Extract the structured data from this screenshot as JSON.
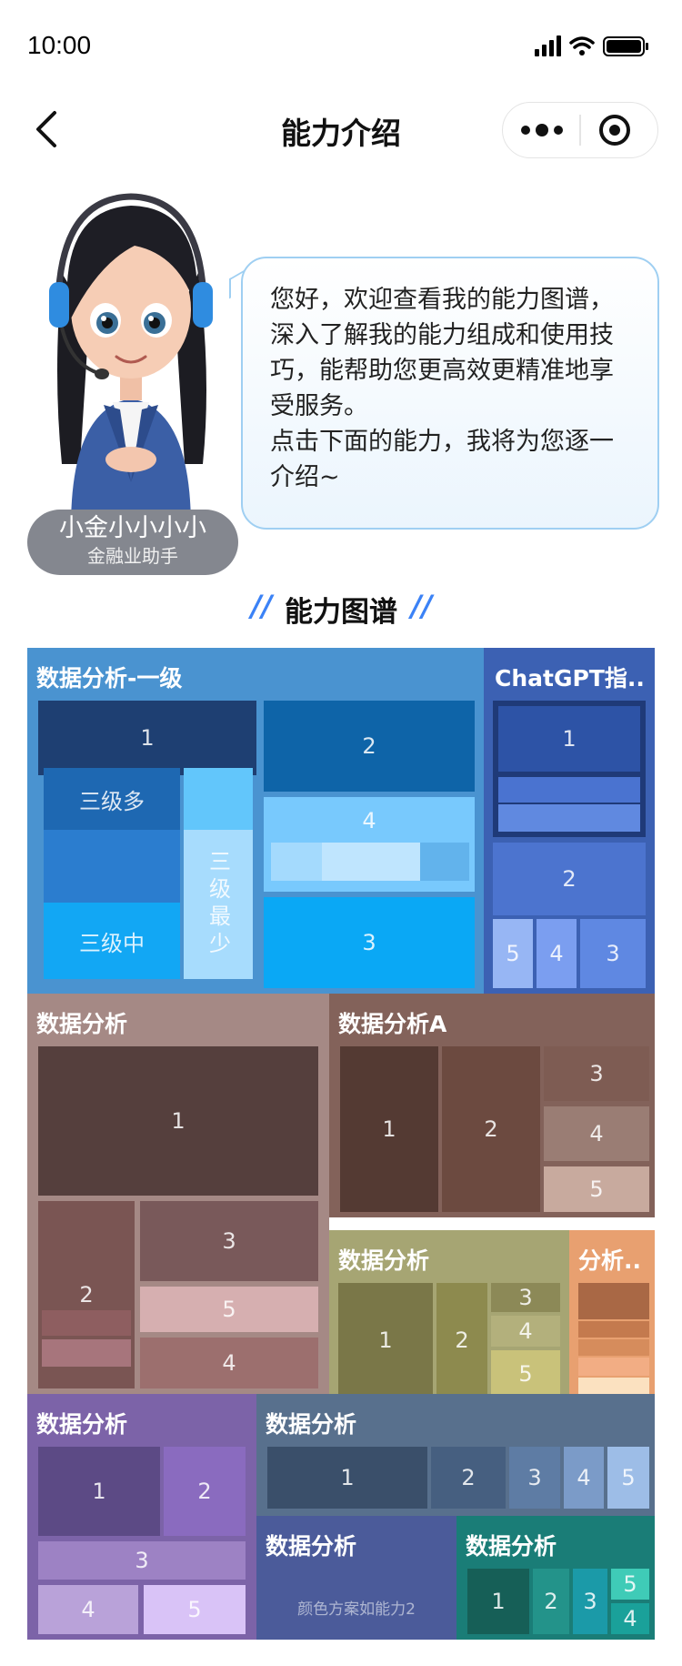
{
  "status_bar": {
    "time": "10:00"
  },
  "nav": {
    "title": "能力介绍"
  },
  "assistant": {
    "name": "小金小小小小",
    "role": "金融业助手",
    "greeting_lines": [
      "您好，欢迎查看我的能力图谱，",
      "深入了解我的能力组成和使用技",
      "巧，能帮助您更高效更精准地享",
      "受服务。",
      "点击下面的能力，我将为您逐一",
      "介绍~"
    ]
  },
  "section": {
    "title": "能力图谱"
  },
  "treemap": {
    "groups": {
      "g1": {
        "title": "数据分析-一级",
        "cells": [
          "1",
          "三级多",
          "三级中",
          "三级最少",
          "2",
          "4",
          "3"
        ]
      },
      "g2": {
        "title": "ChatGPT指..",
        "cells": [
          "1",
          "2",
          "5",
          "4",
          "3"
        ]
      },
      "g3": {
        "title": "数据分析",
        "cells": [
          "1",
          "2",
          "3",
          "5",
          "4"
        ]
      },
      "g4": {
        "title": "数据分析A",
        "cells": [
          "1",
          "2",
          "3",
          "4",
          "5"
        ]
      },
      "g5": {
        "title": "数据分析",
        "cells": [
          "1",
          "2",
          "3",
          "4",
          "5"
        ]
      },
      "g6": {
        "title": "分析..",
        "cells": []
      },
      "g7": {
        "title": "数据分析",
        "cells": [
          "1",
          "2",
          "3",
          "4",
          "5"
        ]
      },
      "g8": {
        "title": "数据分析",
        "cells": [
          "1",
          "2",
          "3",
          "4",
          "5"
        ]
      },
      "g9": {
        "title": "数据分析",
        "note": "颜色方案如能力2"
      },
      "g10": {
        "title": "数据分析",
        "cells": [
          "1",
          "2",
          "3",
          "5",
          "4"
        ]
      }
    }
  }
}
